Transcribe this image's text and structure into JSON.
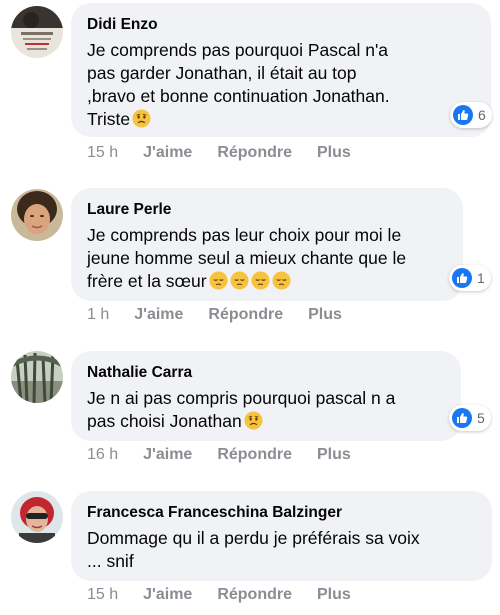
{
  "comments": [
    {
      "author": "Didi Enzo",
      "text": "Je comprends pas pourquoi Pascal n'a\npas garder Jonathan, il était au top\n,bravo et bonne continuation Jonathan.\nTriste",
      "emojis": [
        "sad-face"
      ],
      "reactions": 6,
      "time": "15 h",
      "like_label": "J'aime",
      "reply_label": "Répondre",
      "more_label": "Plus"
    },
    {
      "author": "Laure Perle",
      "text": "Je comprends pas leur choix pour moi le\njeune homme seul a mieux chante que le\nfrère et la sœur",
      "emojis": [
        "pensive-face",
        "pensive-face",
        "pensive-face",
        "pensive-face"
      ],
      "reactions": 1,
      "time": "1 h",
      "like_label": "J'aime",
      "reply_label": "Répondre",
      "more_label": "Plus"
    },
    {
      "author": "Nathalie Carra",
      "text": "Je n ai pas compris pourquoi pascal n a\npas choisi Jonathan",
      "emojis": [
        "sad-face"
      ],
      "reactions": 5,
      "time": "16 h",
      "like_label": "J'aime",
      "reply_label": "Répondre",
      "more_label": "Plus"
    },
    {
      "author": "Francesca Franceschina Balzinger",
      "text": "Dommage qu il a perdu je préférais sa voix\n... snif",
      "emojis": [],
      "reactions": null,
      "time": "15 h",
      "like_label": "J'aime",
      "reply_label": "Répondre",
      "more_label": "Plus"
    }
  ],
  "colors": {
    "bubble": "#f0f2f5",
    "like_blue": "#1877f2",
    "meta_gray": "#8a8d91",
    "emoji_yellow": "#f7c23c"
  }
}
